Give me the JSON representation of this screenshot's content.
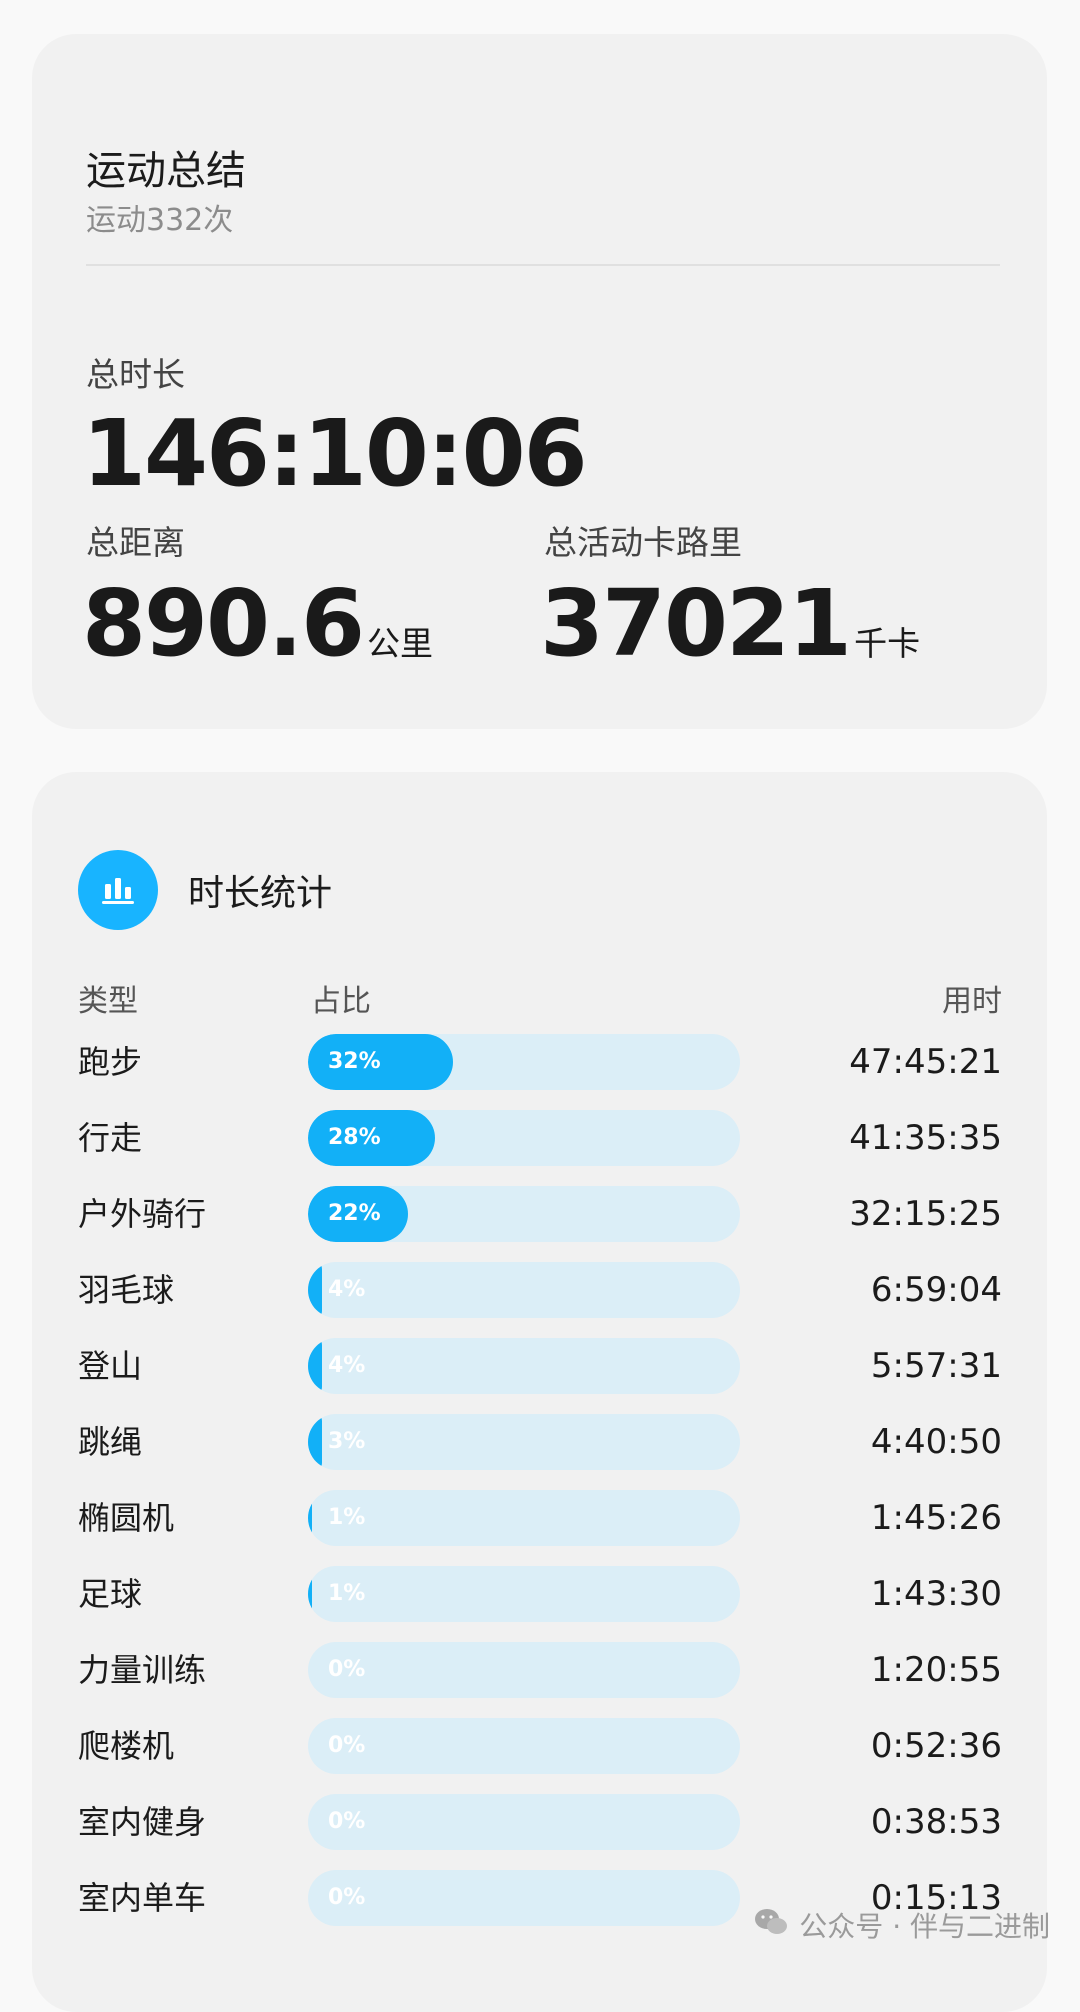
{
  "summary": {
    "title": "运动总结",
    "count_text": "运动332次",
    "total_duration_label": "总时长",
    "total_duration_value": "146:10:06",
    "total_distance_label": "总距离",
    "total_distance_value": "890.6",
    "total_distance_unit": "公里",
    "total_calories_label": "总活动卡路里",
    "total_calories_value": "37021",
    "total_calories_unit": "千卡"
  },
  "duration_stats": {
    "title": "时长统计",
    "icon": "bar-chart-icon",
    "columns": {
      "type": "类型",
      "ratio": "占比",
      "time": "用时"
    },
    "rows": [
      {
        "type": "跑步",
        "pct_label": "32%",
        "pct": 32,
        "time": "47:45:21"
      },
      {
        "type": "行走",
        "pct_label": "28%",
        "pct": 28,
        "time": "41:35:35"
      },
      {
        "type": "户外骑行",
        "pct_label": "22%",
        "pct": 22,
        "time": "32:15:25"
      },
      {
        "type": "羽毛球",
        "pct_label": "4%",
        "pct": 4,
        "time": "6:59:04"
      },
      {
        "type": "登山",
        "pct_label": "4%",
        "pct": 4,
        "time": "5:57:31"
      },
      {
        "type": "跳绳",
        "pct_label": "3%",
        "pct": 3,
        "time": "4:40:50"
      },
      {
        "type": "椭圆机",
        "pct_label": "1%",
        "pct": 1,
        "time": "1:45:26"
      },
      {
        "type": "足球",
        "pct_label": "1%",
        "pct": 1,
        "time": "1:43:30"
      },
      {
        "type": "力量训练",
        "pct_label": "0%",
        "pct": 0,
        "time": "1:20:55"
      },
      {
        "type": "爬楼机",
        "pct_label": "0%",
        "pct": 0,
        "time": "0:52:36"
      },
      {
        "type": "室内健身",
        "pct_label": "0%",
        "pct": 0,
        "time": "0:38:53"
      },
      {
        "type": "室内单车",
        "pct_label": "0%",
        "pct": 0,
        "time": "0:15:13"
      }
    ]
  },
  "colors": {
    "accent": "#12b0f7",
    "bar_track": "#dbeef7",
    "card_bg": "#f1f1f1",
    "page_bg": "#f9f9f9"
  },
  "watermark": {
    "text": "公众号 · 伴与二进制",
    "icon": "wechat-icon"
  }
}
